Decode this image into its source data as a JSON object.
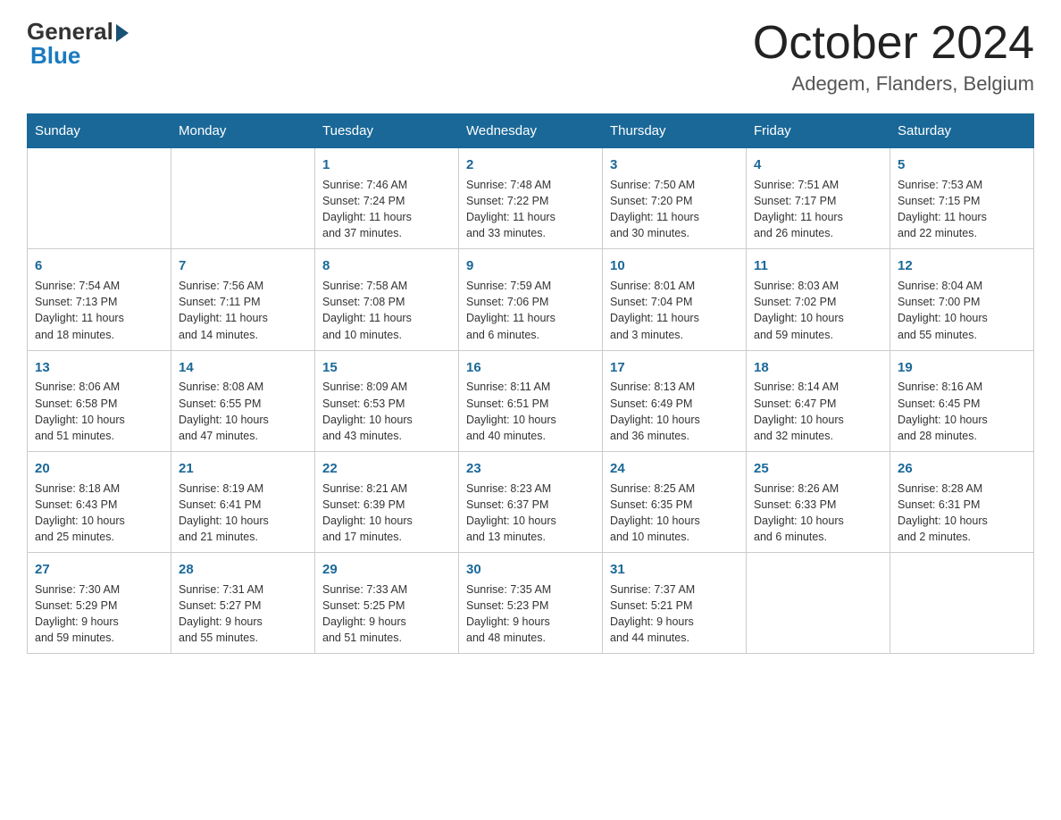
{
  "header": {
    "logo_general": "General",
    "logo_blue": "Blue",
    "month_title": "October 2024",
    "location": "Adegem, Flanders, Belgium"
  },
  "weekdays": [
    "Sunday",
    "Monday",
    "Tuesday",
    "Wednesday",
    "Thursday",
    "Friday",
    "Saturday"
  ],
  "weeks": [
    [
      {
        "day": "",
        "info": ""
      },
      {
        "day": "",
        "info": ""
      },
      {
        "day": "1",
        "info": "Sunrise: 7:46 AM\nSunset: 7:24 PM\nDaylight: 11 hours\nand 37 minutes."
      },
      {
        "day": "2",
        "info": "Sunrise: 7:48 AM\nSunset: 7:22 PM\nDaylight: 11 hours\nand 33 minutes."
      },
      {
        "day": "3",
        "info": "Sunrise: 7:50 AM\nSunset: 7:20 PM\nDaylight: 11 hours\nand 30 minutes."
      },
      {
        "day": "4",
        "info": "Sunrise: 7:51 AM\nSunset: 7:17 PM\nDaylight: 11 hours\nand 26 minutes."
      },
      {
        "day": "5",
        "info": "Sunrise: 7:53 AM\nSunset: 7:15 PM\nDaylight: 11 hours\nand 22 minutes."
      }
    ],
    [
      {
        "day": "6",
        "info": "Sunrise: 7:54 AM\nSunset: 7:13 PM\nDaylight: 11 hours\nand 18 minutes."
      },
      {
        "day": "7",
        "info": "Sunrise: 7:56 AM\nSunset: 7:11 PM\nDaylight: 11 hours\nand 14 minutes."
      },
      {
        "day": "8",
        "info": "Sunrise: 7:58 AM\nSunset: 7:08 PM\nDaylight: 11 hours\nand 10 minutes."
      },
      {
        "day": "9",
        "info": "Sunrise: 7:59 AM\nSunset: 7:06 PM\nDaylight: 11 hours\nand 6 minutes."
      },
      {
        "day": "10",
        "info": "Sunrise: 8:01 AM\nSunset: 7:04 PM\nDaylight: 11 hours\nand 3 minutes."
      },
      {
        "day": "11",
        "info": "Sunrise: 8:03 AM\nSunset: 7:02 PM\nDaylight: 10 hours\nand 59 minutes."
      },
      {
        "day": "12",
        "info": "Sunrise: 8:04 AM\nSunset: 7:00 PM\nDaylight: 10 hours\nand 55 minutes."
      }
    ],
    [
      {
        "day": "13",
        "info": "Sunrise: 8:06 AM\nSunset: 6:58 PM\nDaylight: 10 hours\nand 51 minutes."
      },
      {
        "day": "14",
        "info": "Sunrise: 8:08 AM\nSunset: 6:55 PM\nDaylight: 10 hours\nand 47 minutes."
      },
      {
        "day": "15",
        "info": "Sunrise: 8:09 AM\nSunset: 6:53 PM\nDaylight: 10 hours\nand 43 minutes."
      },
      {
        "day": "16",
        "info": "Sunrise: 8:11 AM\nSunset: 6:51 PM\nDaylight: 10 hours\nand 40 minutes."
      },
      {
        "day": "17",
        "info": "Sunrise: 8:13 AM\nSunset: 6:49 PM\nDaylight: 10 hours\nand 36 minutes."
      },
      {
        "day": "18",
        "info": "Sunrise: 8:14 AM\nSunset: 6:47 PM\nDaylight: 10 hours\nand 32 minutes."
      },
      {
        "day": "19",
        "info": "Sunrise: 8:16 AM\nSunset: 6:45 PM\nDaylight: 10 hours\nand 28 minutes."
      }
    ],
    [
      {
        "day": "20",
        "info": "Sunrise: 8:18 AM\nSunset: 6:43 PM\nDaylight: 10 hours\nand 25 minutes."
      },
      {
        "day": "21",
        "info": "Sunrise: 8:19 AM\nSunset: 6:41 PM\nDaylight: 10 hours\nand 21 minutes."
      },
      {
        "day": "22",
        "info": "Sunrise: 8:21 AM\nSunset: 6:39 PM\nDaylight: 10 hours\nand 17 minutes."
      },
      {
        "day": "23",
        "info": "Sunrise: 8:23 AM\nSunset: 6:37 PM\nDaylight: 10 hours\nand 13 minutes."
      },
      {
        "day": "24",
        "info": "Sunrise: 8:25 AM\nSunset: 6:35 PM\nDaylight: 10 hours\nand 10 minutes."
      },
      {
        "day": "25",
        "info": "Sunrise: 8:26 AM\nSunset: 6:33 PM\nDaylight: 10 hours\nand 6 minutes."
      },
      {
        "day": "26",
        "info": "Sunrise: 8:28 AM\nSunset: 6:31 PM\nDaylight: 10 hours\nand 2 minutes."
      }
    ],
    [
      {
        "day": "27",
        "info": "Sunrise: 7:30 AM\nSunset: 5:29 PM\nDaylight: 9 hours\nand 59 minutes."
      },
      {
        "day": "28",
        "info": "Sunrise: 7:31 AM\nSunset: 5:27 PM\nDaylight: 9 hours\nand 55 minutes."
      },
      {
        "day": "29",
        "info": "Sunrise: 7:33 AM\nSunset: 5:25 PM\nDaylight: 9 hours\nand 51 minutes."
      },
      {
        "day": "30",
        "info": "Sunrise: 7:35 AM\nSunset: 5:23 PM\nDaylight: 9 hours\nand 48 minutes."
      },
      {
        "day": "31",
        "info": "Sunrise: 7:37 AM\nSunset: 5:21 PM\nDaylight: 9 hours\nand 44 minutes."
      },
      {
        "day": "",
        "info": ""
      },
      {
        "day": "",
        "info": ""
      }
    ]
  ]
}
